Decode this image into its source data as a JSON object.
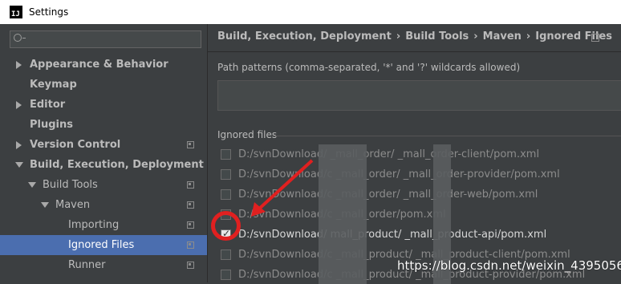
{
  "window": {
    "title": "Settings",
    "app_icon_text": "IJ"
  },
  "sidebar": {
    "items": [
      {
        "label": "Appearance & Behavior",
        "expanded": false
      },
      {
        "label": "Keymap"
      },
      {
        "label": "Editor",
        "expanded": false
      },
      {
        "label": "Plugins"
      },
      {
        "label": "Version Control",
        "expanded": false
      },
      {
        "label": "Build, Execution, Deployment",
        "expanded": true
      },
      {
        "label": "Build Tools",
        "expanded": true
      },
      {
        "label": "Maven",
        "expanded": true
      },
      {
        "label": "Importing"
      },
      {
        "label": "Ignored Files",
        "selected": true
      },
      {
        "label": "Runner"
      }
    ]
  },
  "breadcrumb": [
    "Build, Execution, Deployment",
    "Build Tools",
    "Maven",
    "Ignored Files"
  ],
  "breadcrumb_sep": "›",
  "path_patterns": {
    "label": "Path patterns (comma-separated, '*' and '?' wildcards allowed)",
    "value": ""
  },
  "ignored_files": {
    "label": "Ignored files",
    "rows": [
      {
        "path": "D:/svnDownload/          _mall_order/     _mall_order-client/pom.xml",
        "checked": false
      },
      {
        "path": "D:/svnDownload/c          _mall_order/     _mall_order-provider/pom.xml",
        "checked": false
      },
      {
        "path": "D:/svnDownload/c          _mall_order/     _mall_order-web/pom.xml",
        "checked": false
      },
      {
        "path": "D:/svnDownload/c          _mall_order/pom.xml",
        "checked": false
      },
      {
        "path": "D:/svnDownload/          mall_product/     _mall_product-api/pom.xml",
        "checked": true
      },
      {
        "path": "D:/svnDownload/c          _mall_product/     _mall_product-client/pom.xml",
        "checked": false
      },
      {
        "path": "D:/svnDownload/c          _mall_product/     _mall_product-provider/pom.xml",
        "checked": false
      }
    ]
  },
  "watermark": "https://blog.csdn.net/weixin_43950568",
  "colors": {
    "selection": "#4b6eaf",
    "annotation": "#e02020",
    "background": "#3c3f41"
  }
}
